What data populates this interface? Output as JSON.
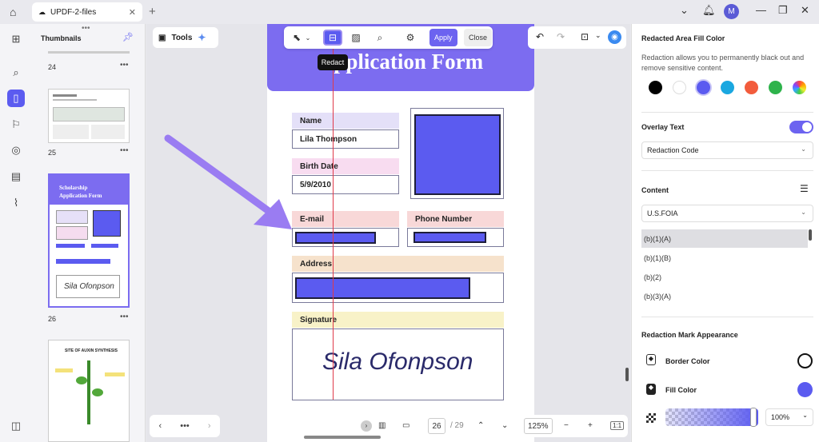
{
  "tab": {
    "title": "UPDF-2-files"
  },
  "user": {
    "initial": "M"
  },
  "thumbnails": {
    "header": "Thumbnails",
    "pages": [
      "24",
      "25",
      "26"
    ],
    "thumb_title_1": "Scholarship",
    "thumb_title_2": "Application Form",
    "thumb_signature": "Sila Ofonpson",
    "thumb_next_title": "SITE OF AUXIN SYNTHESIS"
  },
  "tools": {
    "label": "Tools"
  },
  "toolbar": {
    "apply": "Apply",
    "close": "Close",
    "tooltip": "Redact"
  },
  "document": {
    "title": "Application Form",
    "name_label": "Name",
    "name_value": "Lila Thompson",
    "birth_label": "Birth Date",
    "birth_value": "5/9/2010",
    "email_label": "E-mail",
    "phone_label": "Phone Number",
    "address_label": "Address",
    "signature_label": "Signature",
    "signature_value": "Sila Ofonpson"
  },
  "pagination": {
    "current": "26",
    "total": "/ 29",
    "zoom": "125%"
  },
  "panel": {
    "fill_color_title": "Redacted Area Fill Color",
    "fill_color_desc": "Redaction allows you to permanently black out and remove sensitive content.",
    "colors": [
      "#000000",
      "#ffffff",
      "#5b5bf0",
      "#1aa7e0",
      "#f25c3c",
      "#2eb34b",
      "rainbow"
    ],
    "overlay_title": "Overlay Text",
    "overlay_select": "Redaction Code",
    "content_title": "Content",
    "content_select": "U.S.FOIA",
    "content_items": [
      "(b)(1)(A)",
      "(b)(1)(B)",
      "(b)(2)",
      "(b)(3)(A)"
    ],
    "appearance_title": "Redaction Mark Appearance",
    "border_color_label": "Border Color",
    "fill_color_label": "Fill Color",
    "opacity": "100%"
  }
}
